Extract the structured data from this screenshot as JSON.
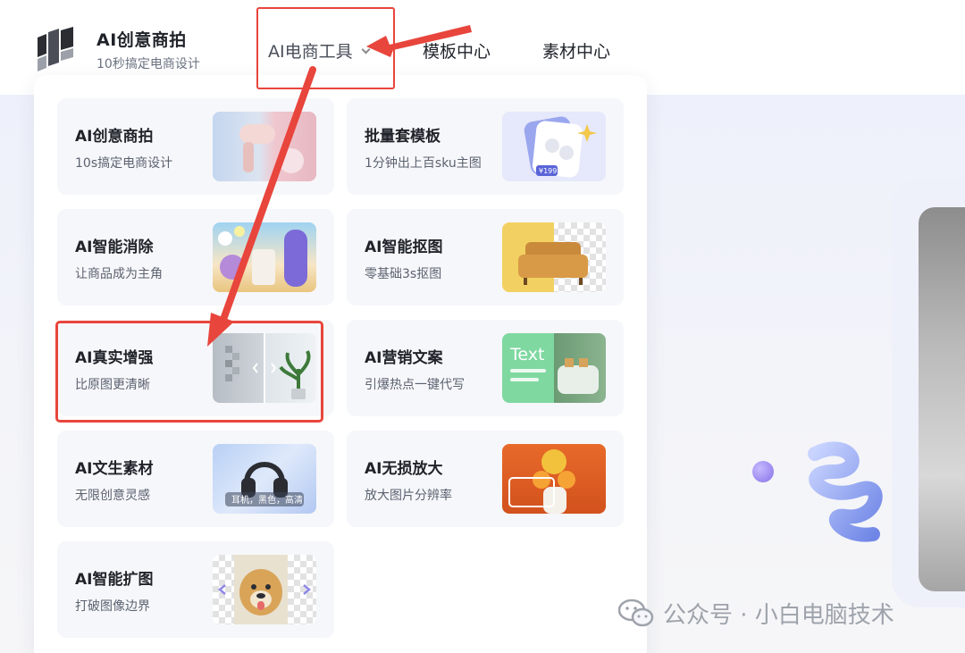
{
  "brand": {
    "title": "AI创意商拍",
    "subtitle": "10秒搞定电商设计"
  },
  "nav": {
    "items": [
      {
        "label": "AI电商工具"
      },
      {
        "label": "模板中心"
      },
      {
        "label": "素材中心"
      }
    ]
  },
  "dropdown": {
    "cards": [
      {
        "title": "AI创意商拍",
        "subtitle": "10s搞定电商设计",
        "thumb": "hair-dryer-photo"
      },
      {
        "title": "批量套模板",
        "subtitle": "1分钟出上百sku主图",
        "thumb": "earbuds-template",
        "price_tag": "¥199"
      },
      {
        "title": "AI智能消除",
        "subtitle": "让商品成为主角",
        "thumb": "cosmetics-photo"
      },
      {
        "title": "AI智能抠图",
        "subtitle": "零基础3s抠图",
        "thumb": "sofa-cutout"
      },
      {
        "title": "AI真实增强",
        "subtitle": "比原图更清晰",
        "thumb": "plant-before-after"
      },
      {
        "title": "AI营销文案",
        "subtitle": "引爆热点一键代写",
        "thumb": "text-toaster",
        "thumb_text": "Text"
      },
      {
        "title": "AI文生素材",
        "subtitle": "无限创意灵感",
        "thumb": "headphones-photo",
        "thumb_caption": "耳机，黑色，高清"
      },
      {
        "title": "AI无损放大",
        "subtitle": "放大图片分辨率",
        "thumb": "girl-oranges-photo"
      },
      {
        "title": "AI智能扩图",
        "subtitle": "打破图像边界",
        "thumb": "dog-photo"
      }
    ]
  },
  "watermark": {
    "text": "公众号 · 小白电脑技术"
  },
  "colors": {
    "annotation_red": "#e8453c",
    "card_bg": "#f6f7fa",
    "accent_purple": "#8672e8"
  }
}
